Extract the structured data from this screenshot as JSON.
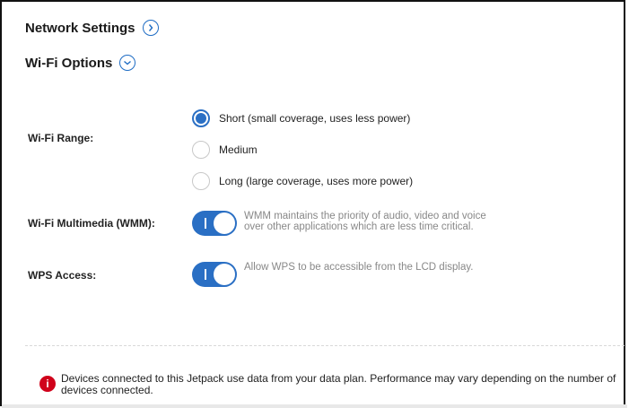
{
  "sections": {
    "network_settings": "Network Settings",
    "wifi_options": "Wi-Fi Options"
  },
  "wifi_range": {
    "label": "Wi-Fi Range:",
    "options": [
      {
        "label": "Short (small coverage, uses less power)",
        "selected": true
      },
      {
        "label": "Medium",
        "selected": false
      },
      {
        "label": "Long (large coverage, uses more power)",
        "selected": false
      }
    ]
  },
  "wmm": {
    "label": "Wi-Fi Multimedia (WMM):",
    "enabled": true,
    "description": "WMM maintains the priority of audio, video and voice over other applications which are less time critical."
  },
  "wps": {
    "label": "WPS Access:",
    "enabled": true,
    "description": "Allow WPS to be accessible from the LCD display."
  },
  "notice": {
    "icon": "info-icon",
    "text": "Devices connected to this Jetpack use data from your data plan. Performance may vary depending on the number of devices connected."
  },
  "colors": {
    "accent": "#2a6fc4",
    "alert": "#d0021b"
  }
}
